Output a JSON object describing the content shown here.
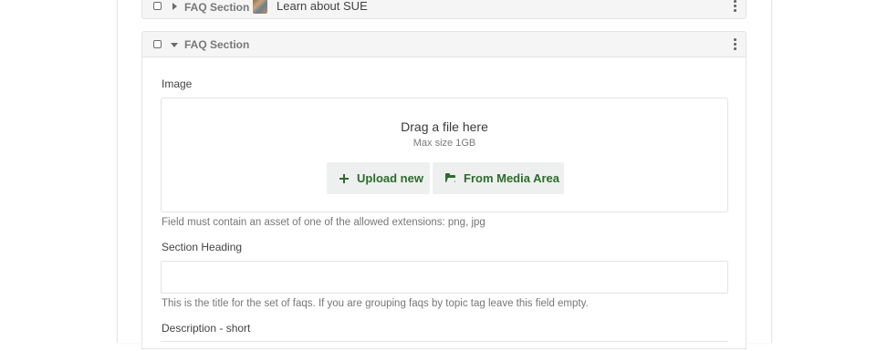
{
  "collapsed_section": {
    "title": "FAQ Section",
    "subtitle": "Learn about SUE"
  },
  "expanded_section": {
    "title": "FAQ Section"
  },
  "image_field": {
    "label": "Image",
    "drop_title": "Drag a file here",
    "max_size": "Max size 1GB",
    "upload_button": "Upload new",
    "media_button": "From Media Area",
    "help": "Field must contain an asset of one of the allowed extensions: png, jpg"
  },
  "heading_field": {
    "label": "Section Heading",
    "value": "",
    "help": "This is the title for the set of faqs. If you are grouping faqs by topic tag leave this field empty."
  },
  "description_field": {
    "label": "Description - short"
  },
  "icons": {
    "collapsed_caret": "caret-right-icon",
    "expanded_caret": "caret-down-icon",
    "menu": "kebab-menu-icon",
    "upload": "plus-icon",
    "media": "folder-open-icon"
  },
  "colors": {
    "accent": "#2d6b2b",
    "bar_bg": "#f5f5f5",
    "button_bg": "#eef0ef"
  }
}
